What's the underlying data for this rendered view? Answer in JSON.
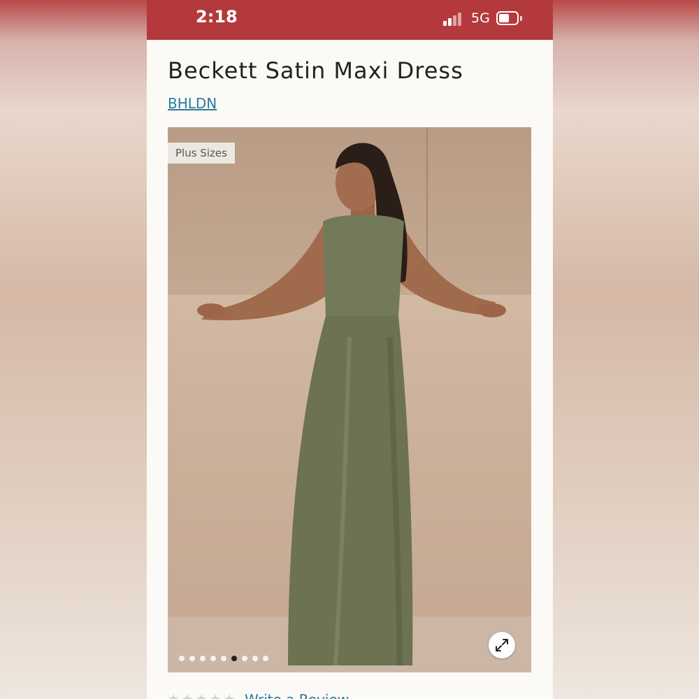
{
  "status_bar": {
    "time": "2:18",
    "network": "5G",
    "battery_level": 0.6
  },
  "product": {
    "title": "Beckett Satin Maxi Dress",
    "brand": "BHLDN",
    "badge": "Plus Sizes",
    "image_count": 9,
    "active_image_index": 5,
    "colors": {
      "dress": "#6f7456",
      "backdrop": "#c9ae98",
      "accent": "#b4393d",
      "link": "#2d7a9e"
    }
  },
  "reviews": {
    "write_label": "Write a Review",
    "star_count": 5,
    "rating": 0
  },
  "icons": {
    "expand": "expand-icon",
    "star": "star-icon",
    "signal": "signal-icon",
    "battery": "battery-icon"
  }
}
